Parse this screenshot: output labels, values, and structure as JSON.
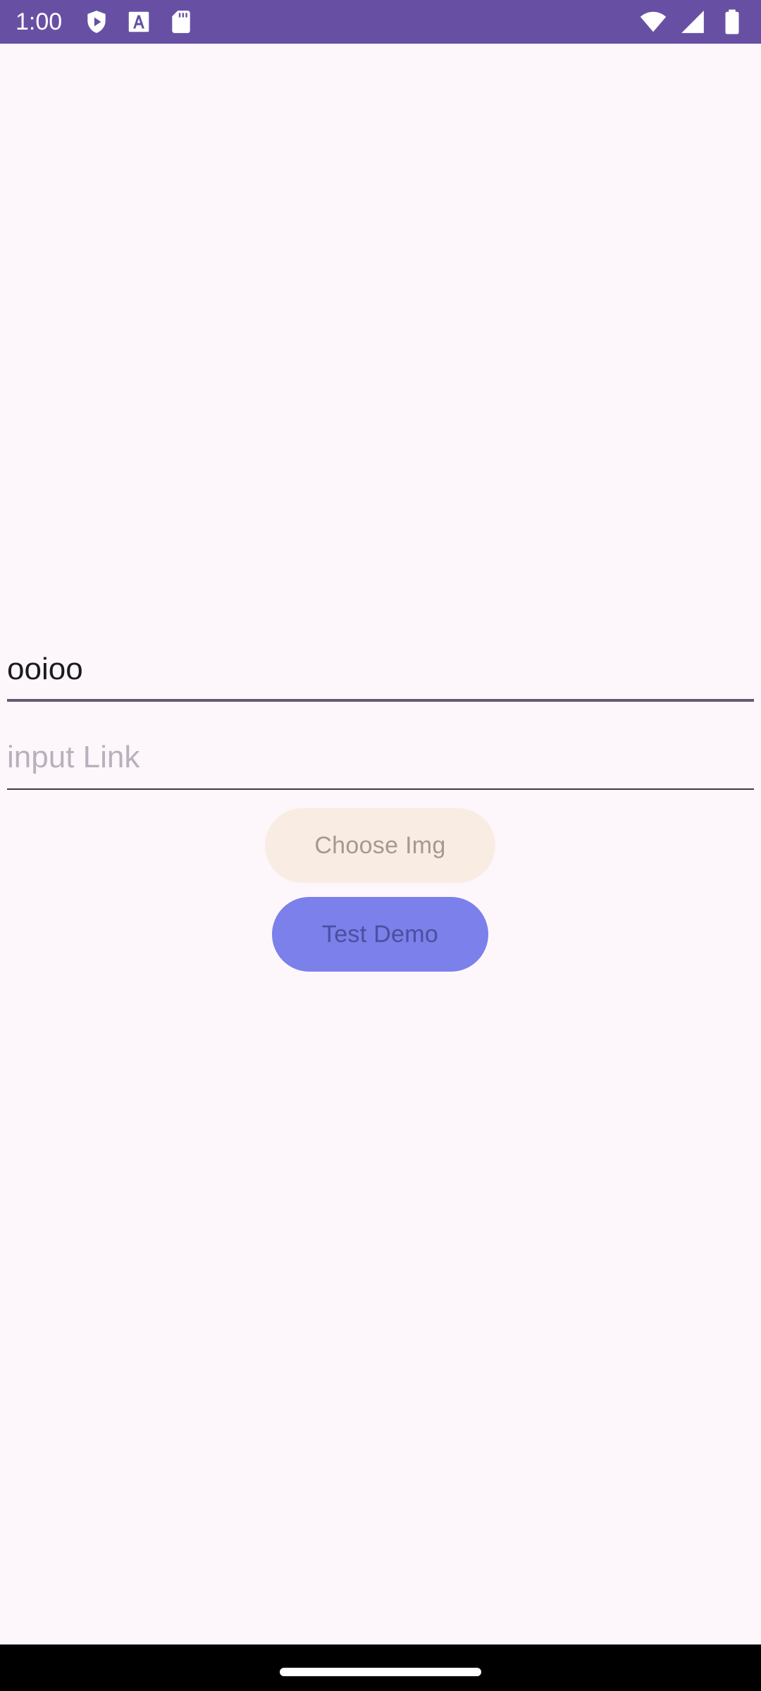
{
  "status_bar": {
    "time": "1:00",
    "background": "#6750a4",
    "left_icons": [
      "shield-play-icon",
      "font-a-icon",
      "sd-card-icon"
    ],
    "right_icons": [
      "wifi-icon",
      "cell-signal-icon",
      "battery-icon"
    ]
  },
  "form": {
    "name_field": {
      "value": "ooioo"
    },
    "link_field": {
      "value": "",
      "placeholder": "input Link"
    },
    "choose_button": {
      "label": "Choose Img",
      "color": "#f9ede3"
    },
    "test_button": {
      "label": "Test Demo",
      "color": "#7b80ea"
    }
  },
  "theme": {
    "background": "#fdf7fc",
    "primary": "#6750a4"
  }
}
